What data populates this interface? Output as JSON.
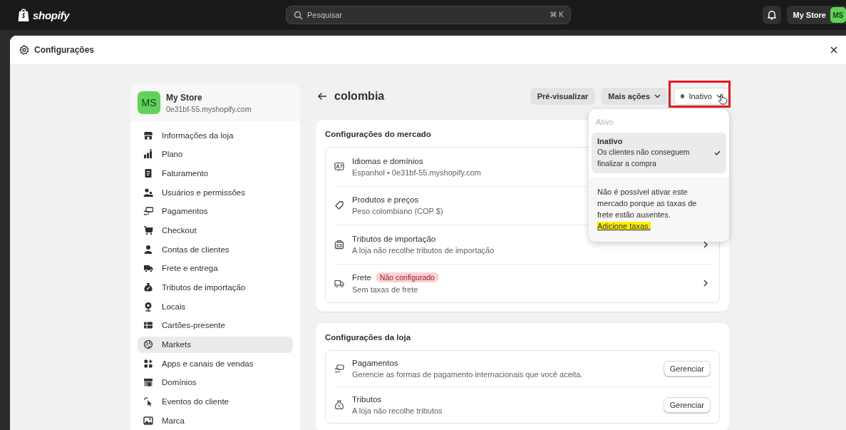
{
  "top_bar": {
    "logo": "shopify",
    "search": {
      "placeholder": "Pesquisar",
      "shortcut": "⌘ K"
    },
    "store_button": {
      "label": "My Store",
      "avatar": "MS"
    }
  },
  "modal": {
    "title": "Configurações"
  },
  "sidebar": {
    "store": {
      "avatar": "MS",
      "name": "My Store",
      "domain": "0e31bf-55.myshopify.com"
    },
    "items": [
      {
        "label": "Informações da loja",
        "selected": false
      },
      {
        "label": "Plano",
        "selected": false
      },
      {
        "label": "Faturamento",
        "selected": false
      },
      {
        "label": "Usuários e permissões",
        "selected": false
      },
      {
        "label": "Pagamentos",
        "selected": false
      },
      {
        "label": "Checkout",
        "selected": false
      },
      {
        "label": "Contas de clientes",
        "selected": false
      },
      {
        "label": "Frete e entrega",
        "selected": false
      },
      {
        "label": "Tributos de importação",
        "selected": false
      },
      {
        "label": "Locais",
        "selected": false
      },
      {
        "label": "Cartões-presente",
        "selected": false
      },
      {
        "label": "Markets",
        "selected": true
      },
      {
        "label": "Apps e canais de vendas",
        "selected": false
      },
      {
        "label": "Domínios",
        "selected": false
      },
      {
        "label": "Eventos do cliente",
        "selected": false
      },
      {
        "label": "Marca",
        "selected": false
      }
    ]
  },
  "page": {
    "title": "colombia",
    "preview_button": "Pré-visualizar",
    "more_button": "Mais ações",
    "status_button": {
      "label": "Inativo",
      "highlighted": true
    }
  },
  "market_settings": {
    "title": "Configurações do mercado",
    "rows": [
      {
        "title": "Idiomas e domínios",
        "subtitle": "Espanhol • 0e31bf-55.myshopify.com",
        "chevron": false
      },
      {
        "title": "Produtos e preços",
        "subtitle": "Peso colombiano (COP $)",
        "chevron": false
      },
      {
        "title": "Tributos de importação",
        "subtitle": "A loja não recolhe tributos de importação",
        "chevron": true
      },
      {
        "title": "Frete",
        "badge": "Não configurado",
        "subtitle": "Sem taxas de frete",
        "chevron": true
      }
    ]
  },
  "store_settings": {
    "title": "Configurações da loja",
    "rows": [
      {
        "title": "Pagamentos",
        "subtitle": "Gerencie as formas de pagamento internacionais que você aceita.",
        "action": "Gerenciar"
      },
      {
        "title": "Tributos",
        "subtitle": "A loja não recolhe tributos",
        "action": "Gerenciar"
      }
    ]
  },
  "status_menu": {
    "options": [
      {
        "label": "Ativo",
        "disabled": true,
        "selected": false
      },
      {
        "label": "Inativo",
        "description": "Os clientes não conseguem finalizar a compra",
        "disabled": false,
        "selected": true
      }
    ],
    "notice": {
      "text": "Não é possível ativar este mercado porque as taxas de frete estão ausentes.",
      "link": "Adicione taxas.",
      "link_highlighted": true
    }
  }
}
